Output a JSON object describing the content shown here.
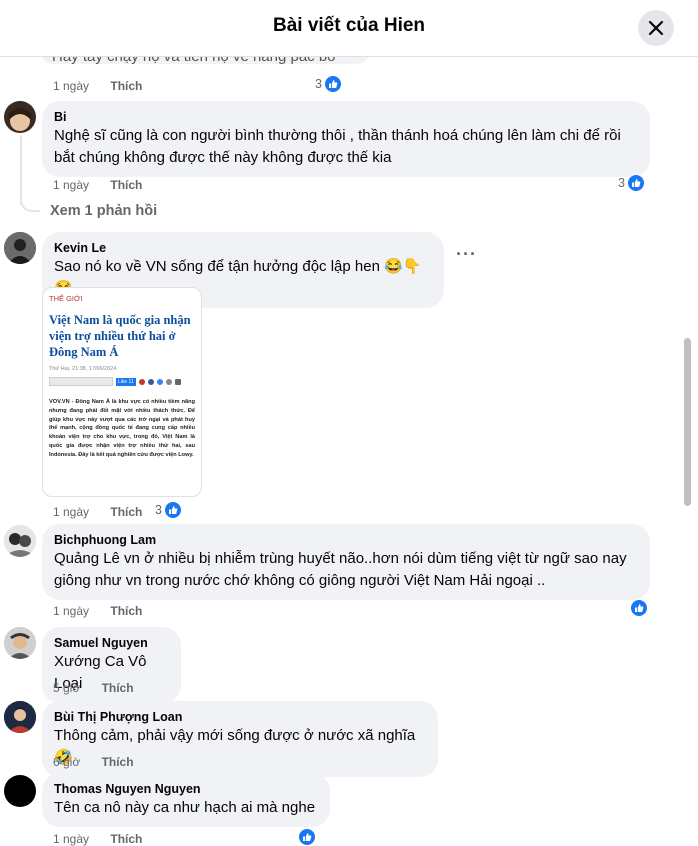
{
  "header": {
    "title": "Bài viết của Hien"
  },
  "top_partial": {
    "text": "Hãy tay chạy hộ và tiến hộ về nàng pác bồ",
    "time": "1 ngày",
    "like_label": "Thích",
    "reactions": "3"
  },
  "comments": [
    {
      "author": "Bi",
      "text_line1": "Nghệ sĩ cũng là con người bình thường thôi , thần thánh hoá chúng lên làm chi để rồi",
      "text_line2": "bắt chúng không được thế này không được thế kia",
      "time": "1 ngày",
      "like_label": "Thích",
      "reactions": "3",
      "replies": "Xem 1 phản hồi"
    },
    {
      "author": "Kevin Le",
      "text": "Sao nó ko về VN sống để tận hưởng độc lập hen 😂👇😂",
      "time": "1 ngày",
      "like_label": "Thích",
      "reactions": "3",
      "article": {
        "category": "THẾ GIỚI",
        "title": "Việt Nam là quốc gia nhận viện trợ nhiều thứ hai ở Đông Nam Á",
        "date": "Thứ Hai, 21:38, 17/06/2024",
        "like_btn": "Like 11",
        "body": "VOV.VN - Đông Nam Á là khu vực có nhiều tiềm năng nhưng đang phải đối mặt với nhiều thách thức. Để giúp khu vực này vượt qua các trở ngại và phát huy thế mạnh, cộng đồng quốc tế đang cung cấp nhiều khoản viện trợ cho khu vực, trong đó, Việt Nam là quốc gia được nhận viện trợ nhiều thứ hai, sau Indonesia. Đây là kết quả nghiên cứu được viện Lowy."
      }
    },
    {
      "author": "Bichphuong Lam",
      "text_line1": "Quảng Lê vn ở nhiều bị nhiễm trùng huyết não..hơn nói dùm tiếng việt từ ngữ sao nay",
      "text_line2": "giông như vn trong nước chớ không có giông người Việt Nam Hải ngoại ..",
      "time": "1 ngày",
      "like_label": "Thích"
    },
    {
      "author": "Samuel Nguyen",
      "text": "Xướng Ca Vô Loại",
      "time": "5 giờ",
      "like_label": "Thích"
    },
    {
      "author": "Bùi Thị Phượng Loan",
      "text": "Thông cảm, phải vậy mới sống được ở nước xã nghĩa 🤣",
      "time": "6 giờ",
      "like_label": "Thích"
    },
    {
      "author": "Thomas Nguyen Nguyen",
      "text": "Tên ca nô này ca như hạch ai mà nghe",
      "time": "1 ngày",
      "like_label": "Thích"
    }
  ],
  "colors": {
    "accent": "#1877f2",
    "bubble": "#f0f2f5",
    "meta": "#65676b"
  }
}
